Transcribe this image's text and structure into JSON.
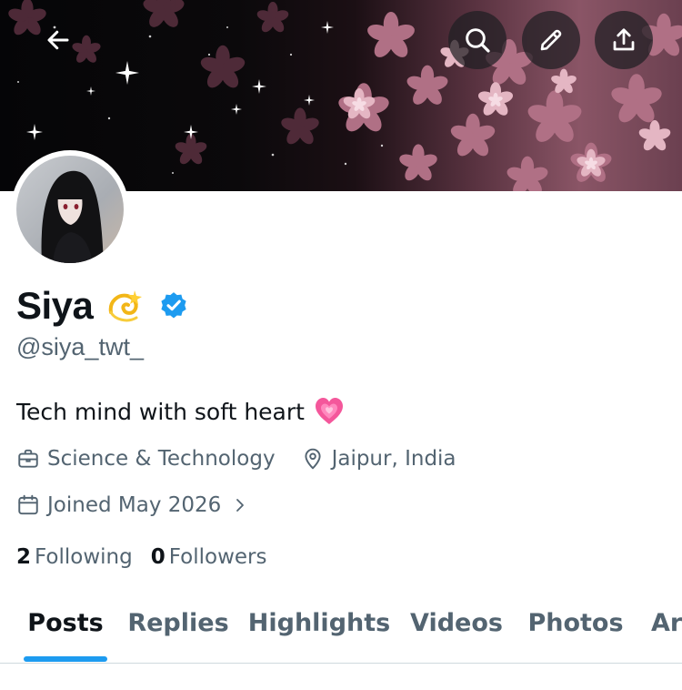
{
  "profile": {
    "name": "Siya",
    "name_emoji": "dizzy",
    "verified": true,
    "handle": "@siya_twt_",
    "bio": "Tech mind with soft heart",
    "bio_emoji": "growing-heart",
    "category": "Science & Technology",
    "location": "Jaipur, India",
    "joined": "Joined May 2026",
    "following_count": "2",
    "following_label": "Following",
    "followers_count": "0",
    "followers_label": "Followers"
  },
  "header_actions": [
    {
      "icon": "back-arrow-icon"
    },
    {
      "icon": "search-icon"
    },
    {
      "icon": "edit-pencil-icon"
    },
    {
      "icon": "share-icon"
    }
  ],
  "tabs": [
    {
      "label": "Posts",
      "active": true
    },
    {
      "label": "Replies",
      "active": false
    },
    {
      "label": "Highlights",
      "active": false
    },
    {
      "label": "Videos",
      "active": false
    },
    {
      "label": "Photos",
      "active": false
    },
    {
      "label": "Articles",
      "active": false
    }
  ],
  "colors": {
    "accent": "#1d9bf0",
    "text_primary": "#0f1419",
    "text_secondary": "#536471",
    "divider": "#cfd9de",
    "verified": "#1d9bf0"
  }
}
